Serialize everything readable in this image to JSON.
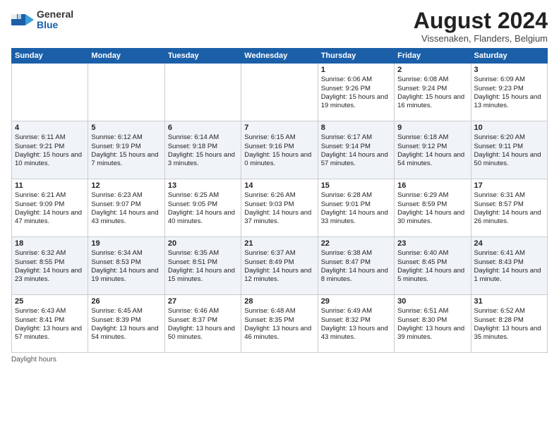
{
  "logo": {
    "general": "General",
    "blue": "Blue"
  },
  "title": "August 2024",
  "location": "Vissenaken, Flanders, Belgium",
  "days_of_week": [
    "Sunday",
    "Monday",
    "Tuesday",
    "Wednesday",
    "Thursday",
    "Friday",
    "Saturday"
  ],
  "weeks": [
    {
      "days": [
        {
          "num": "",
          "info": ""
        },
        {
          "num": "",
          "info": ""
        },
        {
          "num": "",
          "info": ""
        },
        {
          "num": "",
          "info": ""
        },
        {
          "num": "1",
          "info": "Sunrise: 6:06 AM\nSunset: 9:26 PM\nDaylight: 15 hours and 19 minutes."
        },
        {
          "num": "2",
          "info": "Sunrise: 6:08 AM\nSunset: 9:24 PM\nDaylight: 15 hours and 16 minutes."
        },
        {
          "num": "3",
          "info": "Sunrise: 6:09 AM\nSunset: 9:23 PM\nDaylight: 15 hours and 13 minutes."
        }
      ]
    },
    {
      "days": [
        {
          "num": "4",
          "info": "Sunrise: 6:11 AM\nSunset: 9:21 PM\nDaylight: 15 hours and 10 minutes."
        },
        {
          "num": "5",
          "info": "Sunrise: 6:12 AM\nSunset: 9:19 PM\nDaylight: 15 hours and 7 minutes."
        },
        {
          "num": "6",
          "info": "Sunrise: 6:14 AM\nSunset: 9:18 PM\nDaylight: 15 hours and 3 minutes."
        },
        {
          "num": "7",
          "info": "Sunrise: 6:15 AM\nSunset: 9:16 PM\nDaylight: 15 hours and 0 minutes."
        },
        {
          "num": "8",
          "info": "Sunrise: 6:17 AM\nSunset: 9:14 PM\nDaylight: 14 hours and 57 minutes."
        },
        {
          "num": "9",
          "info": "Sunrise: 6:18 AM\nSunset: 9:12 PM\nDaylight: 14 hours and 54 minutes."
        },
        {
          "num": "10",
          "info": "Sunrise: 6:20 AM\nSunset: 9:11 PM\nDaylight: 14 hours and 50 minutes."
        }
      ]
    },
    {
      "days": [
        {
          "num": "11",
          "info": "Sunrise: 6:21 AM\nSunset: 9:09 PM\nDaylight: 14 hours and 47 minutes."
        },
        {
          "num": "12",
          "info": "Sunrise: 6:23 AM\nSunset: 9:07 PM\nDaylight: 14 hours and 43 minutes."
        },
        {
          "num": "13",
          "info": "Sunrise: 6:25 AM\nSunset: 9:05 PM\nDaylight: 14 hours and 40 minutes."
        },
        {
          "num": "14",
          "info": "Sunrise: 6:26 AM\nSunset: 9:03 PM\nDaylight: 14 hours and 37 minutes."
        },
        {
          "num": "15",
          "info": "Sunrise: 6:28 AM\nSunset: 9:01 PM\nDaylight: 14 hours and 33 minutes."
        },
        {
          "num": "16",
          "info": "Sunrise: 6:29 AM\nSunset: 8:59 PM\nDaylight: 14 hours and 30 minutes."
        },
        {
          "num": "17",
          "info": "Sunrise: 6:31 AM\nSunset: 8:57 PM\nDaylight: 14 hours and 26 minutes."
        }
      ]
    },
    {
      "days": [
        {
          "num": "18",
          "info": "Sunrise: 6:32 AM\nSunset: 8:55 PM\nDaylight: 14 hours and 23 minutes."
        },
        {
          "num": "19",
          "info": "Sunrise: 6:34 AM\nSunset: 8:53 PM\nDaylight: 14 hours and 19 minutes."
        },
        {
          "num": "20",
          "info": "Sunrise: 6:35 AM\nSunset: 8:51 PM\nDaylight: 14 hours and 15 minutes."
        },
        {
          "num": "21",
          "info": "Sunrise: 6:37 AM\nSunset: 8:49 PM\nDaylight: 14 hours and 12 minutes."
        },
        {
          "num": "22",
          "info": "Sunrise: 6:38 AM\nSunset: 8:47 PM\nDaylight: 14 hours and 8 minutes."
        },
        {
          "num": "23",
          "info": "Sunrise: 6:40 AM\nSunset: 8:45 PM\nDaylight: 14 hours and 5 minutes."
        },
        {
          "num": "24",
          "info": "Sunrise: 6:41 AM\nSunset: 8:43 PM\nDaylight: 14 hours and 1 minute."
        }
      ]
    },
    {
      "days": [
        {
          "num": "25",
          "info": "Sunrise: 6:43 AM\nSunset: 8:41 PM\nDaylight: 13 hours and 57 minutes."
        },
        {
          "num": "26",
          "info": "Sunrise: 6:45 AM\nSunset: 8:39 PM\nDaylight: 13 hours and 54 minutes."
        },
        {
          "num": "27",
          "info": "Sunrise: 6:46 AM\nSunset: 8:37 PM\nDaylight: 13 hours and 50 minutes."
        },
        {
          "num": "28",
          "info": "Sunrise: 6:48 AM\nSunset: 8:35 PM\nDaylight: 13 hours and 46 minutes."
        },
        {
          "num": "29",
          "info": "Sunrise: 6:49 AM\nSunset: 8:32 PM\nDaylight: 13 hours and 43 minutes."
        },
        {
          "num": "30",
          "info": "Sunrise: 6:51 AM\nSunset: 8:30 PM\nDaylight: 13 hours and 39 minutes."
        },
        {
          "num": "31",
          "info": "Sunrise: 6:52 AM\nSunset: 8:28 PM\nDaylight: 13 hours and 35 minutes."
        }
      ]
    }
  ],
  "footer": "Daylight hours"
}
